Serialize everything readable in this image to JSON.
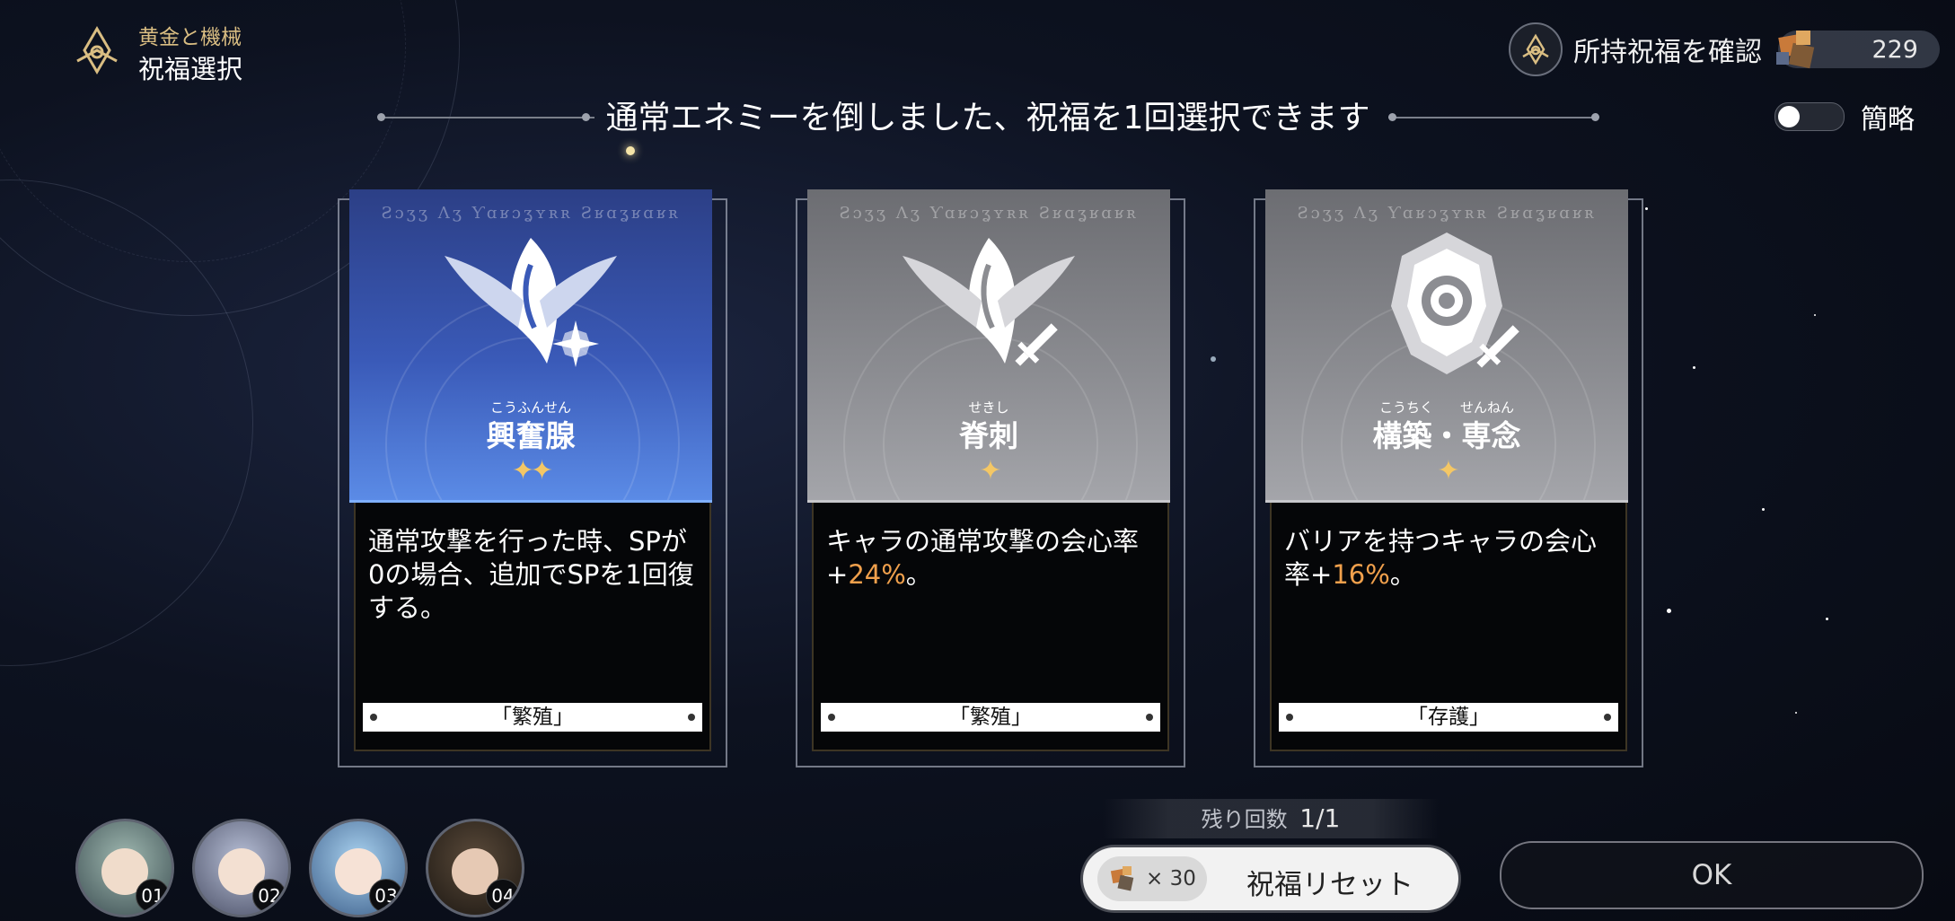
{
  "header": {
    "subtitle": "黄金と機械",
    "title": "祝福選択",
    "check_blessings_label": "所持祝福を確認",
    "currency_value": "229",
    "toggle_label": "簡略",
    "toggle_on": false
  },
  "banner": {
    "text": "通常エネミーを倒しました、祝福を1回選択できます"
  },
  "cards": [
    {
      "rune_text": "Ƨɔʒʒ Λʒ Ƴɑʁɔʓʏʀʀ Ƨʁɑʓʁɑʁʀ",
      "ruby": "こうふんせん",
      "name": "興奮腺",
      "stars": "✦✦",
      "rarity": 2,
      "desc_parts": [
        "通常攻撃を行った時、SPが0の場合、追加でSPを1回復する。"
      ],
      "path": "「繁殖」",
      "accent": "#3f63c4",
      "icon": "propagation-emblem-icon"
    },
    {
      "rune_text": "Ƨɔʒʒ Λʒ Ƴɑʁɔʓʏʀʀ Ƨʁɑʓʁɑʁʀ",
      "ruby": "せきし",
      "name": "脊刺",
      "stars": "✦",
      "rarity": 1,
      "desc_before": "キャラの通常攻撃の会心率+",
      "desc_highlight": "24%",
      "desc_after": "。",
      "path": "「繁殖」",
      "accent": "#8a8b90",
      "icon": "propagation-emblem-icon"
    },
    {
      "rune_text": "Ƨɔʒʒ Λʒ Ƴɑʁɔʓʏʀʀ Ƨʁɑʓʁɑʁʀ",
      "ruby": "こうちく　　せんねん",
      "name": "構築・専念",
      "stars": "✦",
      "rarity": 1,
      "desc_before": "バリアを持つキャラの会心率+",
      "desc_highlight": "16%",
      "desc_after": "。",
      "path": "「存護」",
      "accent": "#8a8b90",
      "icon": "preservation-emblem-icon"
    }
  ],
  "party": [
    {
      "slot": "01"
    },
    {
      "slot": "02"
    },
    {
      "slot": "03"
    },
    {
      "slot": "04"
    }
  ],
  "footer": {
    "remaining_label": "残り回数",
    "remaining_value": "1/1",
    "reset_cost": "× 30",
    "reset_label": "祝福リセット",
    "ok_label": "OK"
  },
  "colors": {
    "gold": "#d9bd82",
    "highlight": "#f0a04c",
    "star": "#f4c765"
  }
}
